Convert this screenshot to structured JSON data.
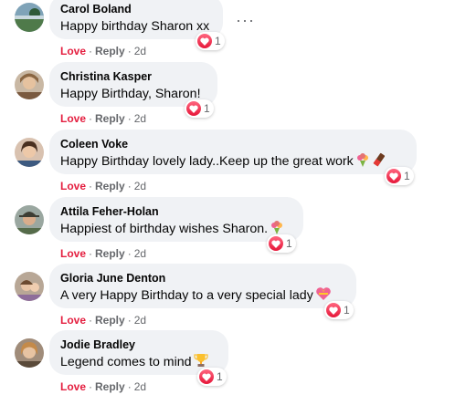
{
  "comments": [
    {
      "name": "Carol Boland",
      "text": "Happy birthday Sharon xx",
      "reaction_count": "1",
      "love": "Love",
      "reply": "Reply",
      "time": "2d",
      "emoji": ""
    },
    {
      "name": "Christina Kasper",
      "text": "Happy Birthday, Sharon!",
      "reaction_count": "1",
      "love": "Love",
      "reply": "Reply",
      "time": "2d",
      "emoji": ""
    },
    {
      "name": "Coleen Voke",
      "text": "Happy Birthday lovely lady..Keep up the great work",
      "reaction_count": "1",
      "love": "Love",
      "reply": "Reply",
      "time": "2d",
      "emoji": "bouquet-and-chocolate-icon"
    },
    {
      "name": "Attila Feher-Holan",
      "text": "Happiest of birthday wishes Sharon.",
      "reaction_count": "1",
      "love": "Love",
      "reply": "Reply",
      "time": "2d",
      "emoji": "bouquet-icon"
    },
    {
      "name": "Gloria June Denton",
      "text": "A very Happy Birthday to a very special lady",
      "reaction_count": "1",
      "love": "Love",
      "reply": "Reply",
      "time": "2d",
      "emoji": "heart-with-ribbon-icon"
    },
    {
      "name": "Jodie Bradley",
      "text": "Legend comes to mind",
      "reaction_count": "1",
      "love": "Love",
      "reply": "Reply",
      "time": "2d",
      "emoji": "trophy-icon"
    }
  ],
  "more_button": "···",
  "colors": {
    "love": "#e41e3f",
    "bubble": "#f0f2f5",
    "meta": "#65676b"
  }
}
